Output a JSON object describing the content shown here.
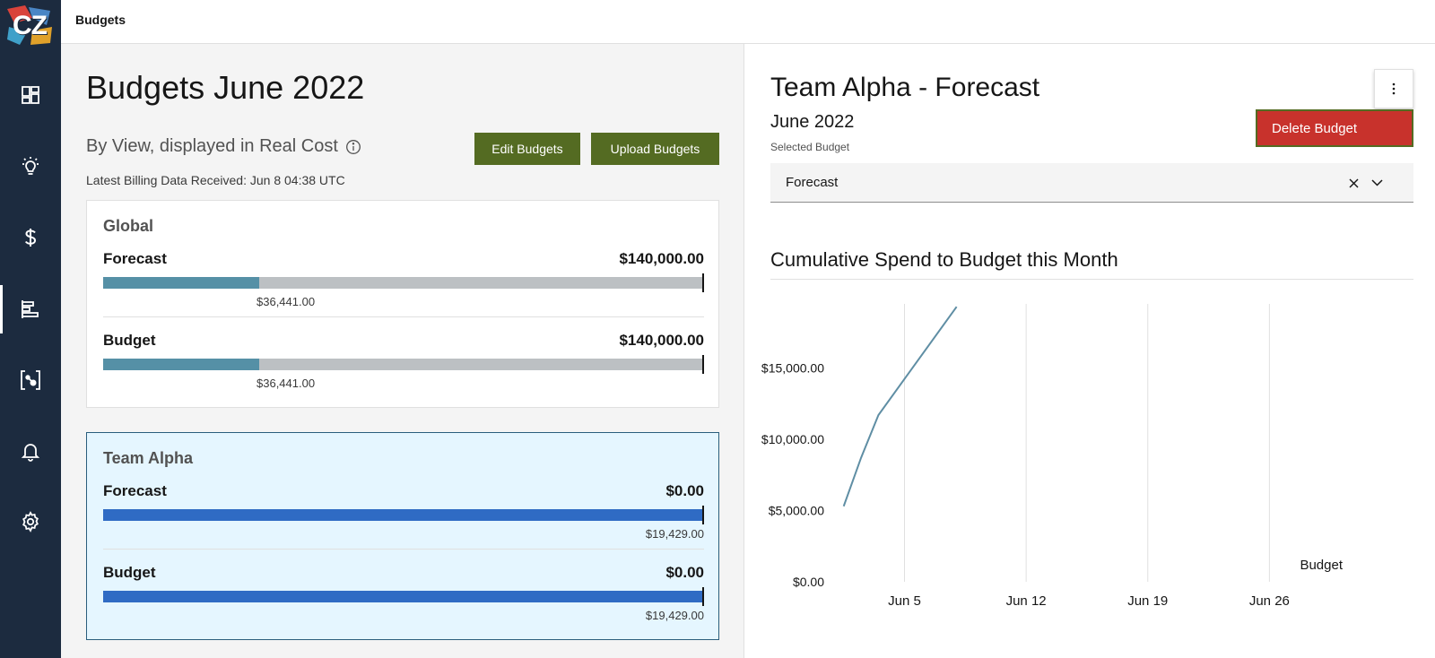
{
  "app": {
    "logo_text": "CZ",
    "header_title": "Budgets"
  },
  "sidebar": {
    "items": [
      {
        "icon": "dashboard-icon"
      },
      {
        "icon": "lightbulb-icon"
      },
      {
        "icon": "dollar-icon"
      },
      {
        "icon": "budgets-icon",
        "active": true
      },
      {
        "icon": "explorer-icon"
      },
      {
        "icon": "bell-icon"
      },
      {
        "icon": "gear-icon"
      }
    ]
  },
  "left": {
    "title": "Budgets June 2022",
    "subtitle": "By View, displayed in Real Cost",
    "edit_label": "Edit Budgets",
    "upload_label": "Upload Budgets",
    "billing_note": "Latest Billing Data Received: Jun 8 04:38 UTC",
    "cards": [
      {
        "name": "Global",
        "rows": [
          {
            "label": "Forecast",
            "amount": "$140,000.00",
            "spent": "$36,441.00",
            "fill": 0.26
          },
          {
            "label": "Budget",
            "amount": "$140,000.00",
            "spent": "$36,441.00",
            "fill": 0.26
          }
        ]
      },
      {
        "name": "Team Alpha",
        "rows": [
          {
            "label": "Forecast",
            "amount": "$0.00",
            "spent": "$19,429.00",
            "fill": 1.0
          },
          {
            "label": "Budget",
            "amount": "$0.00",
            "spent": "$19,429.00",
            "fill": 1.0
          }
        ]
      }
    ]
  },
  "right": {
    "title": "Team Alpha - Forecast",
    "month": "June 2022",
    "selected_label": "Selected Budget",
    "selected_value": "Forecast",
    "delete_label": "Delete Budget",
    "chart_title": "Cumulative Spend to Budget this Month"
  },
  "colors": {
    "sidebar": "#1c2b3f",
    "button": "#546b22",
    "delete": "#c8322c",
    "bar_global": "#5590a6",
    "bar_alpha": "#2f6bc4",
    "line": "#5f8ea4"
  },
  "chart_data": {
    "type": "line",
    "ylabel": "",
    "xlabel": "",
    "y_ticks": [
      "$0.00",
      "$5,000.00",
      "$10,000.00",
      "$15,000.00"
    ],
    "y_tick_values": [
      0,
      5000,
      10000,
      15000
    ],
    "x_ticks": [
      "Jun 5",
      "Jun 12",
      "Jun 19",
      "Jun 26"
    ],
    "x_tick_values": [
      5,
      12,
      19,
      26
    ],
    "xlim": [
      1,
      33
    ],
    "ylim": [
      0,
      19500
    ],
    "grid": "vertical",
    "series": [
      {
        "values": [
          [
            1.5,
            5300
          ],
          [
            2.5,
            8700
          ],
          [
            3.5,
            11700
          ],
          [
            8.0,
            19300
          ]
        ]
      }
    ],
    "annotation": "Budget"
  }
}
